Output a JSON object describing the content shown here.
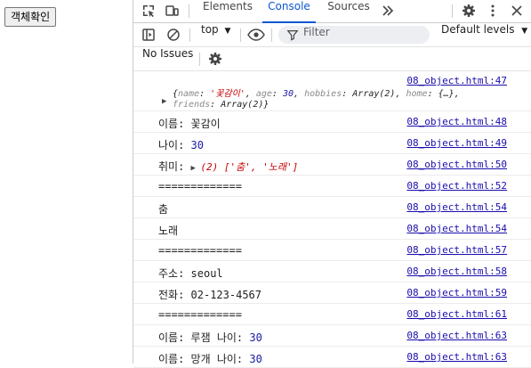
{
  "page": {
    "button_label": "객체확인"
  },
  "devtools": {
    "tabs": [
      "Elements",
      "Console",
      "Sources"
    ],
    "active_tab": "Console",
    "toolbar": {
      "context": "top",
      "filter_placeholder": "Filter",
      "levels": "Default levels"
    },
    "issues": "No Issues"
  },
  "console": {
    "object_line": {
      "source": "08_object.html:47",
      "open": "{",
      "k_name": "name",
      "v_name": "'꽃감이'",
      "k_age": "age",
      "v_age": "30",
      "k_hobbies": "hobbies",
      "v_hobbies": "Array(2)",
      "k_home": "home",
      "v_home": "{…}",
      "k_friends": "friends",
      "v_friends": "Array(2)",
      "close": "}"
    },
    "rows": [
      {
        "text_a": "이름: 꽃감이",
        "num": "",
        "source": "08_object.html:48"
      },
      {
        "text_a": "나이: ",
        "num": "30",
        "source": "08_object.html:49"
      },
      {
        "text_a": "취미: ",
        "array": "(2) ['춤', '노래']",
        "source": "08_object.html:50"
      },
      {
        "text_a": "=============",
        "num": "",
        "source": "08_object.html:52"
      },
      {
        "text_a": "춤",
        "num": "",
        "source": "08_object.html:54"
      },
      {
        "text_a": "노래",
        "num": "",
        "source": "08_object.html:54"
      },
      {
        "text_a": "=============",
        "num": "",
        "source": "08_object.html:57"
      },
      {
        "text_a": "주소: seoul",
        "num": "",
        "source": "08_object.html:58"
      },
      {
        "text_a": "전화: 02-123-4567",
        "num": "",
        "source": "08_object.html:59"
      },
      {
        "text_a": "=============",
        "num": "",
        "source": "08_object.html:61"
      },
      {
        "text_a": "이름: 루잼 나이: ",
        "num": "30",
        "source": "08_object.html:63"
      },
      {
        "text_a": "이름: 망개 나이: ",
        "num": "30",
        "source": "08_object.html:63"
      }
    ]
  }
}
